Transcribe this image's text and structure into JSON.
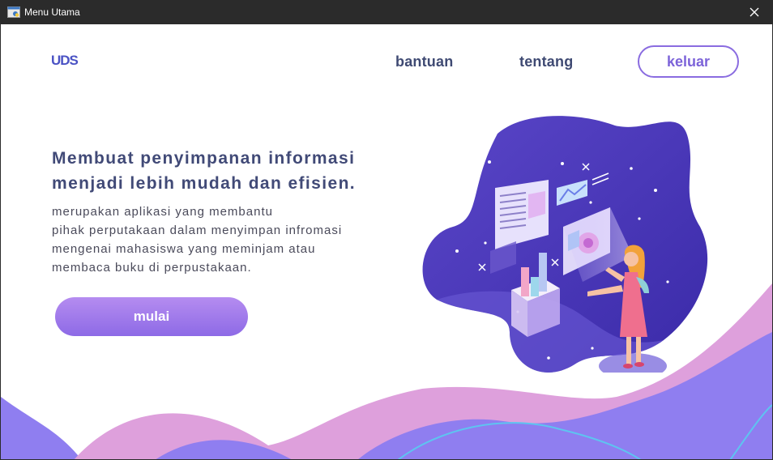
{
  "window": {
    "title": "Menu Utama",
    "app_icon": "python-window-icon",
    "close_icon": "close-icon"
  },
  "header": {
    "logo_text": "UDS",
    "nav": [
      "bantuan",
      "tentang"
    ],
    "exit_label": "keluar"
  },
  "hero": {
    "headline": [
      "Membuat penyimpanan informasi",
      "menjadi lebih mudah dan efisien."
    ],
    "description": [
      "merupakan aplikasi yang membantu",
      "pihak perputakaan dalam menyimpan infromasi",
      "mengenai mahasiswa yang meminjam atau",
      "membaca buku di perpustakaan."
    ],
    "cta_label": "mulai"
  },
  "colors": {
    "accent": "#8a6ce0",
    "heading": "#414a77",
    "wave_pink": "#dea0dc",
    "wave_purple": "#8f7ef0",
    "blob": "#4d3bbd"
  }
}
